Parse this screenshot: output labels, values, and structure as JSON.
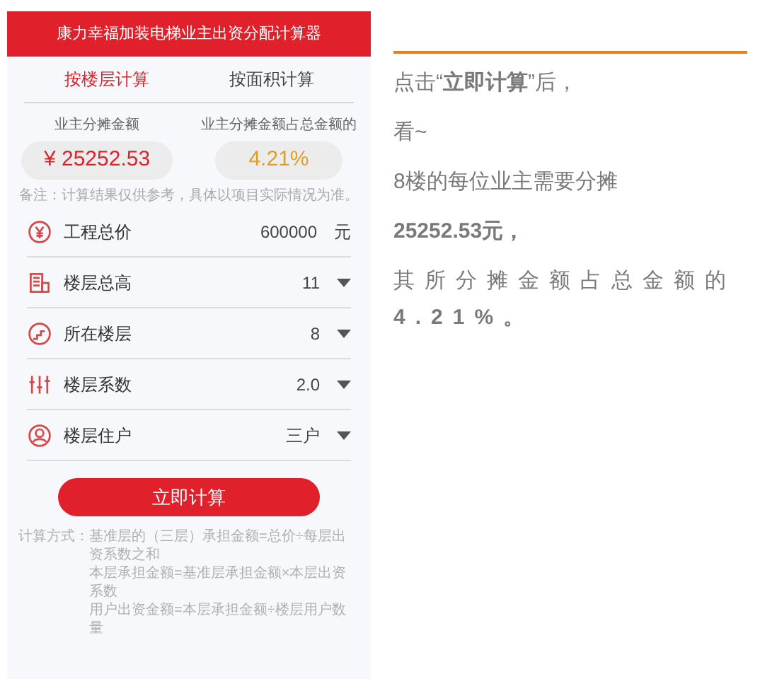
{
  "app": {
    "title": "康力幸福加装电梯业主出资分配计算器",
    "tabs": [
      {
        "label": "按楼层计算",
        "selected": true
      },
      {
        "label": "按面积计算",
        "selected": false
      }
    ],
    "results": [
      {
        "label": "业主分摊金额",
        "value": "¥ 25252.53",
        "color": "#d7262e"
      },
      {
        "label": "业主分摊金额占总金额的",
        "value": "4.21%",
        "color": "#e0a028"
      }
    ],
    "note": "备注：计算结果仅供参考，具体以项目实际情况为准。",
    "fields": [
      {
        "kind": "input",
        "label": "工程总价",
        "value": "600000",
        "unit": "元"
      },
      {
        "kind": "select",
        "label": "楼层总高",
        "value": "11"
      },
      {
        "kind": "select",
        "label": "所在楼层",
        "value": "8"
      },
      {
        "kind": "select",
        "label": "楼层系数",
        "value": "2.0"
      },
      {
        "kind": "select",
        "label": "楼层住户",
        "value": "三户"
      }
    ],
    "button": "立即计算",
    "formula": {
      "label": "计算方式：",
      "lines": [
        "基准层的（三层）承担金额=总价÷每层出资系数之和",
        "本层承担金额=基准层承担金额×本层出资系数",
        "用户出资金额=本层承担金额÷楼层用户数量"
      ]
    }
  },
  "article": {
    "paragraphs": [
      "点击“**立即计算**”后，",
      "看~",
      "8楼的每位业主需要分摊",
      "**25252.53元，**",
      "其所分摊金额占总金额的**4.21%。**"
    ]
  }
}
